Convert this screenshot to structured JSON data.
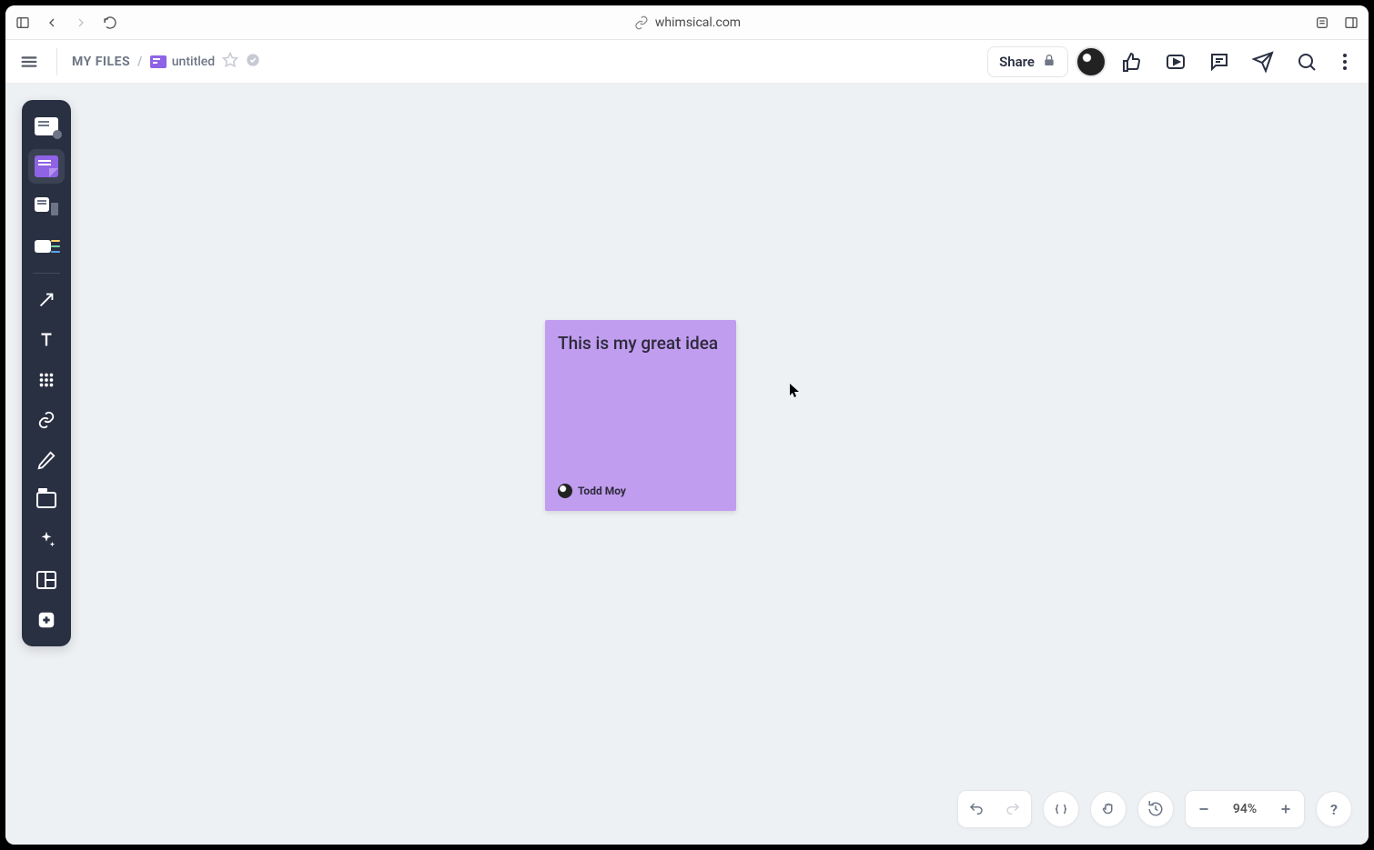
{
  "browser": {
    "url": "whimsical.com"
  },
  "header": {
    "breadcrumb_root": "MY FILES",
    "file_name": "untitled",
    "share_label": "Share"
  },
  "tools": {
    "flowchart": "flowchart-tool",
    "sticky": "sticky-note-tool",
    "wireframe": "wireframe-tool",
    "mindmap": "mindmap-tool",
    "arrow": "connector-tool",
    "text": "text-tool",
    "grid": "table-tool",
    "link": "link-tool",
    "pencil": "draw-tool",
    "section": "section-tool",
    "ai": "ai-tool",
    "template": "template-tool",
    "add": "add-tool"
  },
  "canvas": {
    "sticky": {
      "text": "This is my great idea",
      "author": "Todd Moy",
      "color": "#c19df0"
    }
  },
  "bottom": {
    "zoom": "94%"
  }
}
